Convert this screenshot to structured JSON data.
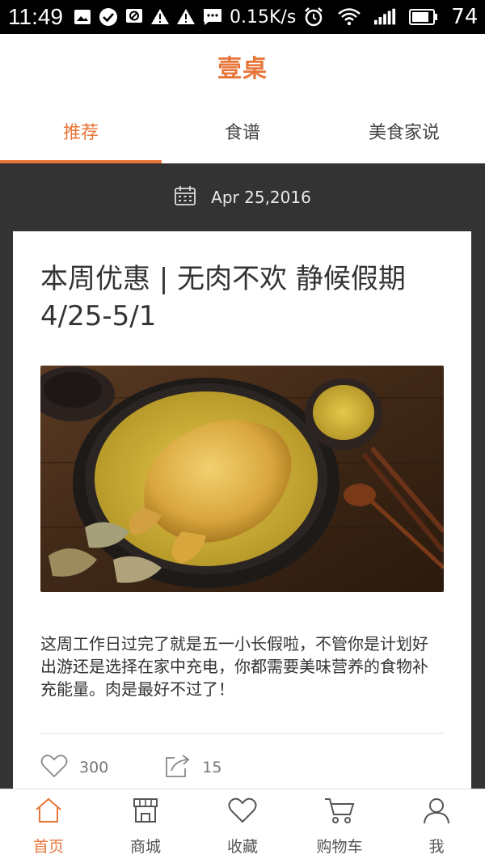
{
  "status_bar": {
    "time": "11:49",
    "speed": "0.15K/s",
    "battery": "74",
    "icons": [
      "image-icon",
      "check-circle-icon",
      "blocked-message-icon",
      "warning-icon",
      "warning-icon",
      "sms-icon",
      "alarm-icon",
      "wifi-icon",
      "signal-icon",
      "battery-icon"
    ]
  },
  "app": {
    "logo": "壹桌",
    "accent_color": "#e8763b"
  },
  "tabs": [
    {
      "label": "推荐",
      "active": true
    },
    {
      "label": "食谱",
      "active": false
    },
    {
      "label": "美食家说",
      "active": false
    }
  ],
  "feed": {
    "date": "Apr 25,2016",
    "article": {
      "title": "本周优惠 | 无肉不欢 静候假期4/25-5/1",
      "image_alt": "砂锅焖鸡与小米饭",
      "body": "这周工作日过完了就是五一小长假啦，不管你是计划好出游还是选择在家中充电，你都需要美味营养的食物补充能量。肉是最好不过了！",
      "likes": "300",
      "shares": "15"
    }
  },
  "bottom_nav": [
    {
      "label": "首页",
      "icon": "home-icon",
      "active": true
    },
    {
      "label": "商城",
      "icon": "store-icon",
      "active": false
    },
    {
      "label": "收藏",
      "icon": "heart-icon",
      "active": false
    },
    {
      "label": "购物车",
      "icon": "cart-icon",
      "active": false
    },
    {
      "label": "我",
      "icon": "user-icon",
      "active": false
    }
  ]
}
